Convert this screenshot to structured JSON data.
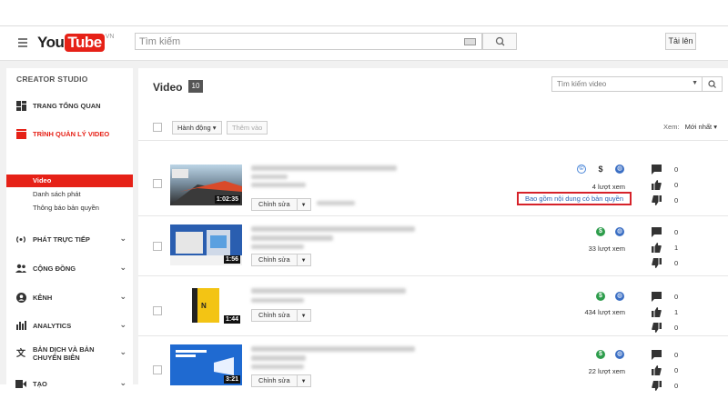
{
  "header": {
    "logo_you": "You",
    "logo_tube": "Tube",
    "logo_region": "VN",
    "search_placeholder": "Tìm kiếm",
    "upload_label": "Tải lên"
  },
  "sidebar": {
    "title": "CREATOR STUDIO",
    "items": [
      {
        "label": "TRANG TỔNG QUAN",
        "icon": "dashboard-icon"
      },
      {
        "label": "TRÌNH QUẢN LÝ VIDEO",
        "icon": "video-manager-icon"
      },
      {
        "label": "PHÁT TRỰC TIẾP",
        "icon": "live-stream-icon"
      },
      {
        "label": "CỘNG ĐỒNG",
        "icon": "community-icon"
      },
      {
        "label": "KÊNH",
        "icon": "channel-icon"
      },
      {
        "label": "ANALYTICS",
        "icon": "analytics-icon"
      },
      {
        "label": "BẢN DỊCH VÀ BẢN CHUYỂN BIÊN",
        "icon": "translate-icon"
      },
      {
        "label": "TẠO",
        "icon": "create-icon"
      }
    ],
    "subitems": [
      "Video",
      "Danh sách phát",
      "Thông báo bản quyền"
    ]
  },
  "main": {
    "title": "Video",
    "count": "10",
    "search_placeholder": "Tìm kiếm video",
    "actions_label": "Hành động",
    "add_to_label": "Thêm vào",
    "sort_label": "Xem:",
    "sort_value": "Mới nhất",
    "edit_label": "Chỉnh sửa",
    "copyright_notice": "Bao gồm nội dung có bản quyền",
    "videos": [
      {
        "duration": "1:02:35",
        "views": "4 lượt xem",
        "comments": "0",
        "likes": "0",
        "dislikes": "0"
      },
      {
        "duration": "1:56",
        "views": "33 lượt xem",
        "comments": "0",
        "likes": "1",
        "dislikes": "0"
      },
      {
        "duration": "1:44",
        "views": "434 lượt xem",
        "comments": "0",
        "likes": "1",
        "dislikes": "0"
      },
      {
        "duration": "3:21",
        "views": "22 lượt xem",
        "comments": "0",
        "likes": "0",
        "dislikes": "0"
      }
    ]
  }
}
